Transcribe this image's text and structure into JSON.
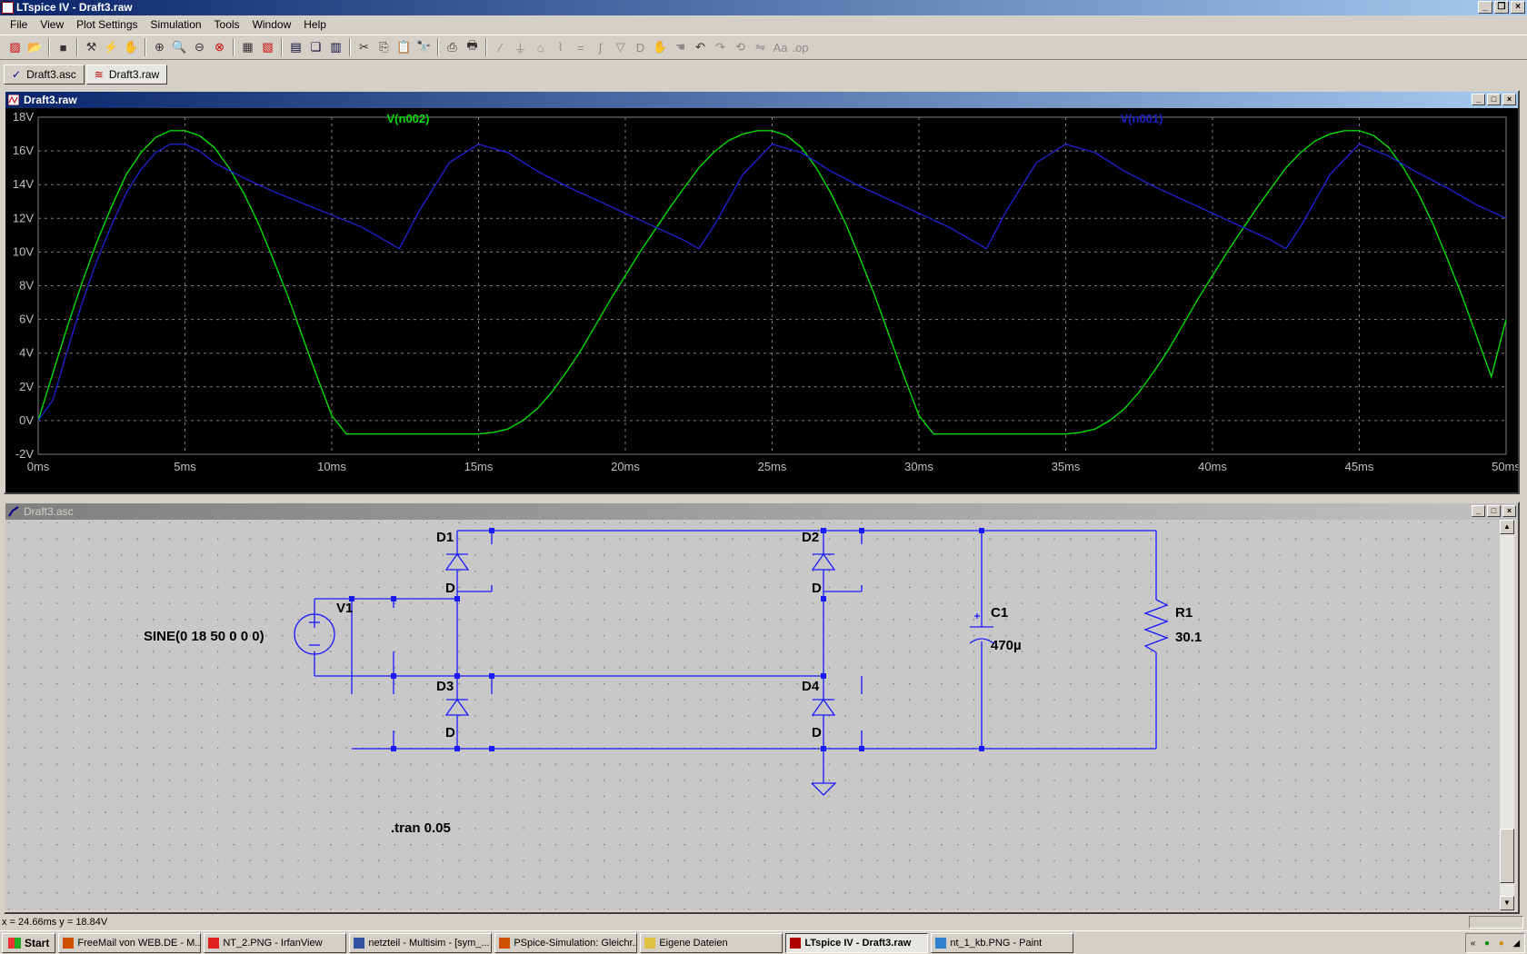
{
  "window": {
    "title": "LTspice IV - Draft3.raw"
  },
  "menu": [
    "File",
    "View",
    "Plot Settings",
    "Simulation",
    "Tools",
    "Window",
    "Help"
  ],
  "tabs": [
    {
      "label": "Draft3.asc",
      "icon": "schematic-icon"
    },
    {
      "label": "Draft3.raw",
      "icon": "waveform-icon"
    }
  ],
  "plot_window": {
    "title": "Draft3.raw"
  },
  "schematic_window": {
    "title": "Draft3.asc"
  },
  "colors": {
    "trace_n002": "#00dd00",
    "trace_n001": "#2020c8",
    "plot_bg": "#000000",
    "wire": "#1a1aff",
    "schem_bg": "#c8c8c8"
  },
  "chart_data": {
    "type": "line",
    "xlabel": "",
    "ylabel": "",
    "xlim": [
      0,
      50
    ],
    "ylim": [
      -2,
      18
    ],
    "x_ticks": [
      "0ms",
      "5ms",
      "10ms",
      "15ms",
      "20ms",
      "25ms",
      "30ms",
      "35ms",
      "40ms",
      "45ms",
      "50ms"
    ],
    "y_ticks": [
      "-2V",
      "0V",
      "2V",
      "4V",
      "6V",
      "8V",
      "10V",
      "12V",
      "14V",
      "16V",
      "18V"
    ],
    "grid": true,
    "series": [
      {
        "name": "V(n002)",
        "color": "#00dd00",
        "x": [
          0,
          0.5,
          1,
          1.5,
          2,
          2.5,
          3,
          3.5,
          4,
          4.5,
          5,
          5.5,
          6,
          6.5,
          7,
          7.5,
          8,
          8.5,
          9,
          9.5,
          10,
          10.5,
          11,
          11.5,
          12,
          12.5,
          13,
          13.5,
          14,
          14.5,
          15,
          15.5,
          16,
          16.5,
          17,
          17.5,
          18,
          18.5,
          19,
          19.5,
          20,
          20.5,
          21,
          21.5,
          22,
          22.5,
          23,
          23.5,
          24,
          24.5,
          25,
          25.5,
          26,
          26.5,
          27,
          27.5,
          28,
          28.5,
          29,
          29.5,
          30,
          30.5,
          31,
          31.5,
          32,
          32.5,
          33,
          33.5,
          34,
          34.5,
          35,
          35.5,
          36,
          36.5,
          37,
          37.5,
          38,
          38.5,
          39,
          39.5,
          40,
          40.5,
          41,
          41.5,
          42,
          42.5,
          43,
          43.5,
          44,
          44.5,
          45,
          45.5,
          46,
          46.5,
          47,
          47.5,
          48,
          48.5,
          49,
          49.5,
          50
        ],
        "y": [
          0,
          2.8,
          5.6,
          8.2,
          10.6,
          12.7,
          14.6,
          15.9,
          16.8,
          17.2,
          17.2,
          16.9,
          16.2,
          15.0,
          13.5,
          11.7,
          9.6,
          7.4,
          5.0,
          2.6,
          0.3,
          -0.8,
          -0.8,
          -0.8,
          -0.8,
          -0.8,
          -0.8,
          -0.8,
          -0.8,
          -0.8,
          -0.8,
          -0.7,
          -0.5,
          0,
          0.7,
          1.7,
          2.9,
          4.2,
          5.7,
          7.2,
          8.6,
          10.0,
          11.3,
          12.6,
          13.8,
          15.0,
          15.9,
          16.6,
          17.0,
          17.2,
          17.2,
          16.9,
          16.2,
          15.0,
          13.5,
          11.7,
          9.6,
          7.4,
          5.0,
          2.6,
          0.3,
          -0.8,
          -0.8,
          -0.8,
          -0.8,
          -0.8,
          -0.8,
          -0.8,
          -0.8,
          -0.8,
          -0.8,
          -0.7,
          -0.5,
          0,
          0.7,
          1.7,
          2.9,
          4.2,
          5.7,
          7.2,
          8.6,
          10.0,
          11.3,
          12.6,
          13.8,
          15.0,
          15.9,
          16.6,
          17.0,
          17.2,
          17.2,
          16.9,
          16.2,
          15.0,
          13.5,
          11.7,
          9.6,
          7.4,
          5.0,
          2.6,
          6.0
        ]
      },
      {
        "name": "V(n001)",
        "color": "#2020c8",
        "x": [
          0,
          0.5,
          1,
          1.5,
          2,
          2.5,
          3,
          3.5,
          4,
          4.5,
          5,
          5.5,
          6,
          7,
          8,
          9,
          10,
          11,
          12.3,
          13,
          14,
          15,
          16,
          17,
          18,
          19,
          20,
          21,
          22,
          22.5,
          23,
          24,
          25,
          26,
          27,
          28,
          29,
          30,
          31,
          32.3,
          33,
          34,
          35,
          36,
          37,
          38,
          39,
          40,
          41,
          42,
          42.5,
          43,
          44,
          45,
          46,
          47,
          48,
          49,
          50
        ],
        "y": [
          0,
          1.2,
          4.2,
          7.0,
          9.5,
          11.6,
          13.5,
          14.9,
          15.9,
          16.4,
          16.4,
          16.0,
          15.3,
          14.4,
          13.6,
          12.9,
          12.2,
          11.5,
          10.2,
          12.5,
          15.3,
          16.4,
          15.9,
          14.8,
          13.9,
          13.1,
          12.3,
          11.5,
          10.7,
          10.2,
          11.5,
          14.6,
          16.4,
          15.9,
          14.8,
          13.9,
          13.1,
          12.3,
          11.5,
          10.2,
          12.5,
          15.3,
          16.4,
          15.9,
          14.8,
          13.9,
          13.1,
          12.3,
          11.5,
          10.7,
          10.2,
          11.5,
          14.6,
          16.4,
          15.7,
          14.7,
          13.8,
          12.8,
          12.0
        ]
      }
    ]
  },
  "schematic": {
    "components": {
      "d1": "D1",
      "d2": "D2",
      "d3": "D3",
      "d4": "D4",
      "d_value": "D",
      "v1": "V1",
      "v1_value": "SINE(0 18 50 0 0 0)",
      "c1": "C1",
      "c1_value": "470µ",
      "r1": "R1",
      "r1_value": "30.1"
    },
    "directive": ".tran 0.05"
  },
  "status": {
    "coords": "x = 24.66ms    y = 18.84V"
  },
  "taskbar": {
    "start": "Start",
    "tasks": [
      {
        "label": "FreeMail von WEB.DE - M...",
        "icon_color": "#d05000",
        "active": false
      },
      {
        "label": "NT_2.PNG - IrfanView",
        "icon_color": "#e02020",
        "active": false
      },
      {
        "label": "netzteil - Multisim - [sym_...",
        "icon_color": "#3050a0",
        "active": false
      },
      {
        "label": "PSpice-Simulation: Gleichr...",
        "icon_color": "#d05000",
        "active": false
      },
      {
        "label": "Eigene Dateien",
        "icon_color": "#e0c040",
        "active": false
      },
      {
        "label": "LTspice IV - Draft3.raw",
        "icon_color": "#b00000",
        "active": true
      },
      {
        "label": "nt_1_kb.PNG - Paint",
        "icon_color": "#3080d0",
        "active": false
      }
    ]
  }
}
